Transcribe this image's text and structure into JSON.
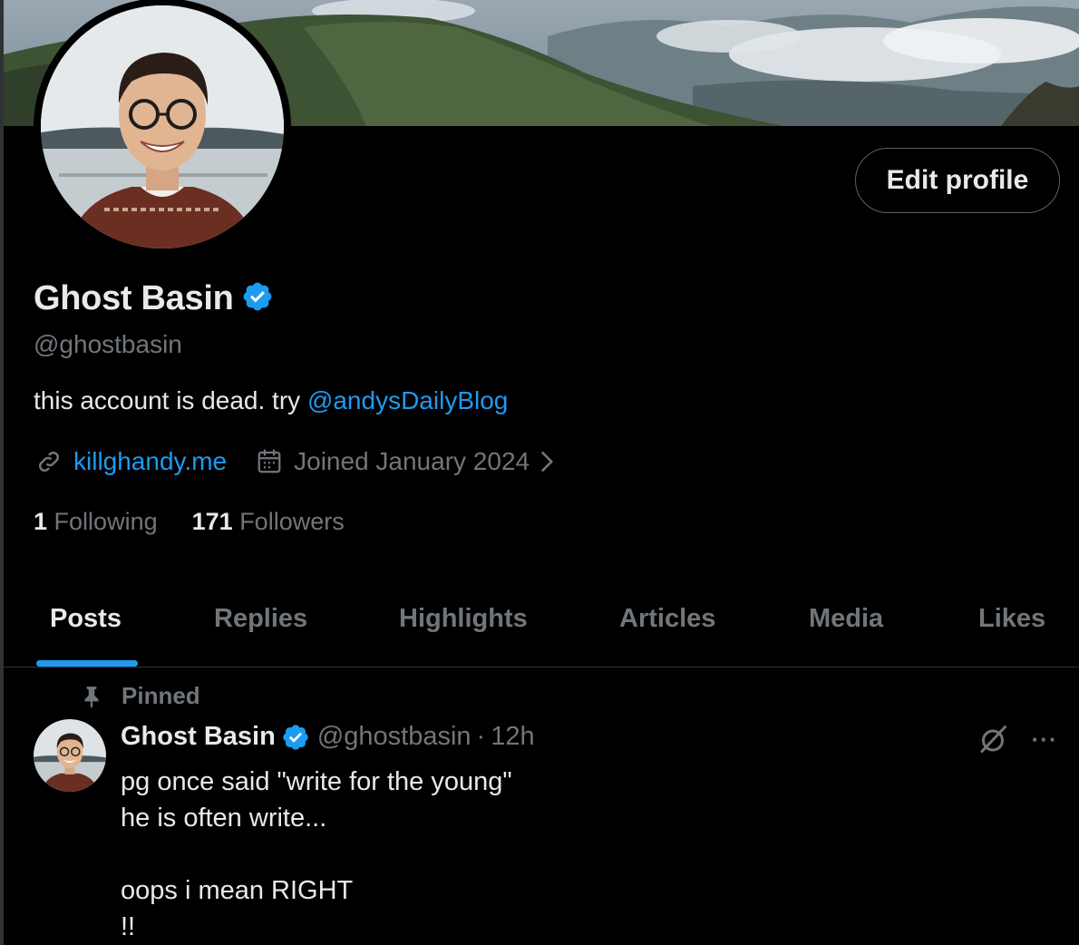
{
  "profile": {
    "display_name": "Ghost Basin",
    "handle": "@ghostbasin",
    "bio_text": "this account is dead. try ",
    "bio_mention": "@andysDailyBlog",
    "website": "killghandy.me",
    "joined": "Joined January 2024",
    "following_count": "1",
    "following_label": "Following",
    "followers_count": "171",
    "followers_label": "Followers",
    "edit_label": "Edit profile",
    "verified_icon": "verified-badge-icon"
  },
  "tabs": [
    {
      "label": "Posts",
      "active": true
    },
    {
      "label": "Replies",
      "active": false
    },
    {
      "label": "Highlights",
      "active": false
    },
    {
      "label": "Articles",
      "active": false
    },
    {
      "label": "Media",
      "active": false
    },
    {
      "label": "Likes",
      "active": false
    }
  ],
  "pinned_post": {
    "pinned_label": "Pinned",
    "author_name": "Ghost Basin",
    "author_handle": "@ghostbasin",
    "time": "12h",
    "body": "pg once said \"write for the young\"\nhe is often write...\n\noops i mean RIGHT\n!!"
  },
  "colors": {
    "accent": "#1d9bf0",
    "background": "#000000",
    "text_primary": "#e7e9ea",
    "text_secondary": "#71767b",
    "border": "#2f3336"
  },
  "icons": [
    "link-icon",
    "calendar-icon",
    "chevron-right-icon",
    "pin-icon",
    "grok-icon",
    "more-icon",
    "verified-badge-icon"
  ]
}
